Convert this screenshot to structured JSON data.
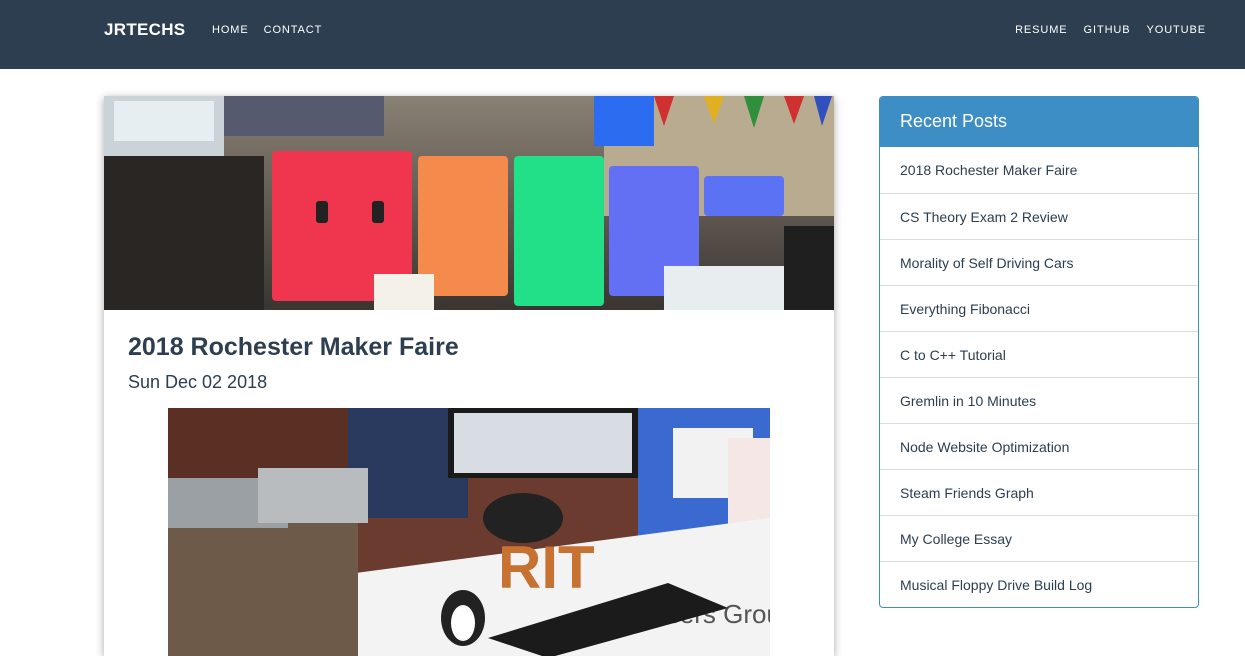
{
  "navbar": {
    "brand": "JRTECHS",
    "left_links": [
      "HOME",
      "CONTACT"
    ],
    "right_links": [
      "RESUME",
      "GITHUB",
      "YOUTUBE"
    ]
  },
  "post": {
    "title": "2018 Rochester Maker Faire",
    "date": "Sun Dec 02 2018"
  },
  "sidebar": {
    "heading": "Recent Posts",
    "items": [
      "2018 Rochester Maker Faire",
      "CS Theory Exam 2 Review",
      "Morality of Self Driving Cars",
      "Everything Fibonacci",
      "C to C++ Tutorial",
      "Gremlin in 10 Minutes",
      "Node Website Optimization",
      "Steam Friends Graph",
      "My College Essay",
      "Musical Floppy Drive Build Log"
    ]
  },
  "colors": {
    "navbar": "#2c3e50",
    "accent": "#3e8ec6",
    "text": "#2c3e50"
  }
}
